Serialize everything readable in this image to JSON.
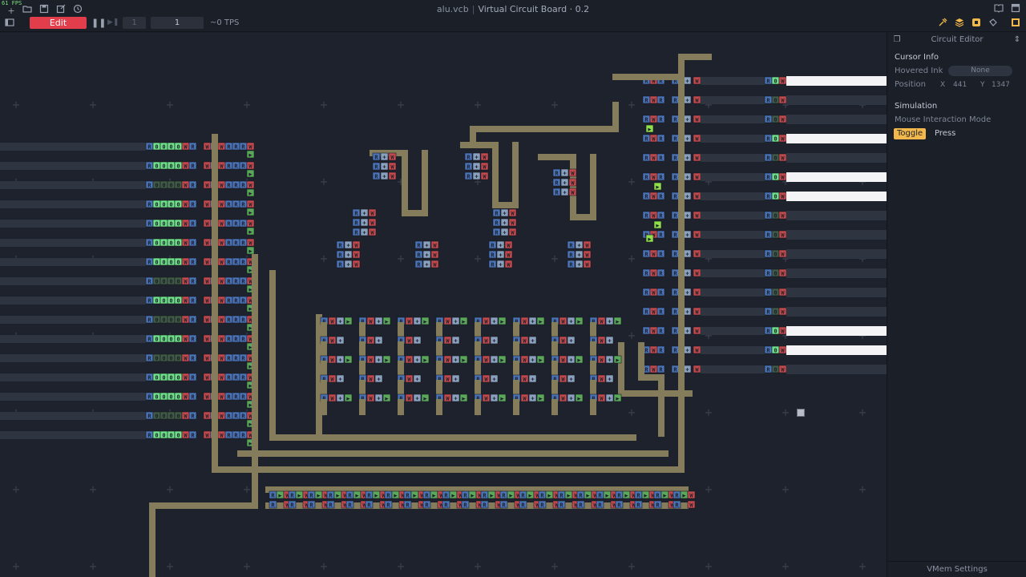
{
  "top": {
    "fps": "61 FPS",
    "file_name": "alu.vcb",
    "separator": "|",
    "app_title": "Virtual Circuit Board · 0.2",
    "edit_label": "Edit",
    "step_value": "1",
    "speed_value": "1",
    "tps_label": "~0 TPS",
    "icons_left": [
      "add-icon",
      "open-folder-icon",
      "save-icon",
      "save-as-icon",
      "settings-icon",
      "sidebar-toggle-icon"
    ],
    "icons_right": [
      "tools-icon",
      "layers-icon",
      "ink-icon",
      "bucket-icon",
      "book-icon",
      "window-icon",
      "panel-icon"
    ]
  },
  "panel": {
    "header": "Circuit Editor",
    "cursor_info": {
      "title": "Cursor Info",
      "hovered_label": "Hovered Ink",
      "hovered_value": "None",
      "position_label": "Position",
      "x_label": "X",
      "x_value": "441",
      "y_label": "Y",
      "y_value": "1347"
    },
    "simulation": {
      "title": "Simulation",
      "mode_label": "Mouse Interaction Mode",
      "toggle_label": "Toggle",
      "press_label": "Press"
    },
    "footer": "VMem Settings"
  },
  "board": {
    "left_inputs": 16,
    "right_outputs": 16,
    "left_active_rows": [
      0,
      1,
      3,
      4,
      5,
      6,
      8,
      10,
      12,
      13,
      15
    ],
    "right_lit_rows": [
      0,
      3,
      5,
      6,
      13,
      14
    ],
    "colors": {
      "background": "#1e222c",
      "trace": "#857c5c",
      "wire_off": "#2f3441",
      "wire_lit": "#f4f4f6",
      "read": "#4a73b8",
      "write": "#c84a4e",
      "cross": "#8aa0bf",
      "buffer": "#5aa85a",
      "latch_on": "#6fe08a",
      "accent": "#e23d4a",
      "toggle": "#f2b84b"
    }
  }
}
